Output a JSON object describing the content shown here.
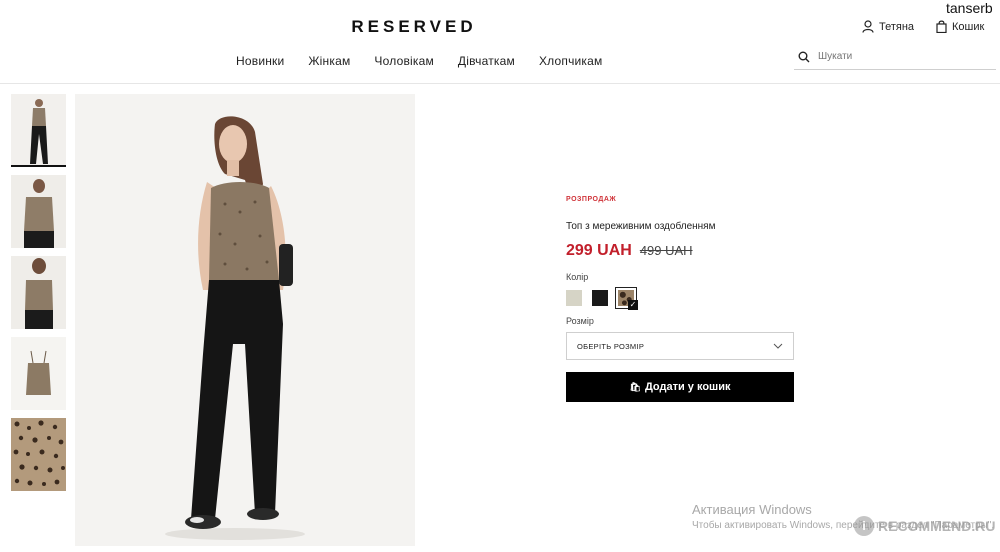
{
  "header": {
    "logo": "RESERVED",
    "user_name": "Тетяна",
    "cart_label": "Кошик",
    "overlay_username": "tanserb"
  },
  "nav": {
    "items": [
      "Новинки",
      "Жінкам",
      "Чоловікам",
      "Дівчаткам",
      "Хлопчикам"
    ]
  },
  "search": {
    "placeholder": "Шукати"
  },
  "product": {
    "badge": "РОЗПРОДАЖ",
    "title": "Топ з мереживним оздобленням",
    "price": "299 UAH",
    "old_price": "499 UAH",
    "color_label": "Колір",
    "colors": [
      "#d6d4c6",
      "#1a1a1a",
      "leopard"
    ],
    "size_label": "Розмір",
    "size_placeholder": "ОБЕРІТЬ РОЗМІР",
    "add_to_cart": "Додати у кошик",
    "check_mark": "✓",
    "cart_icon_glyph": "🛍"
  },
  "watermarks": {
    "windows_title": "Активация Windows",
    "windows_sub": "Чтобы активировать Windows, перейдите в раздел \"Параметры\".",
    "recommend": "RECOMMEND.RU",
    "recommend_glyph": "i"
  },
  "colors": {
    "sale": "#d0343a",
    "price": "#c21f2b",
    "button": "#000000"
  }
}
